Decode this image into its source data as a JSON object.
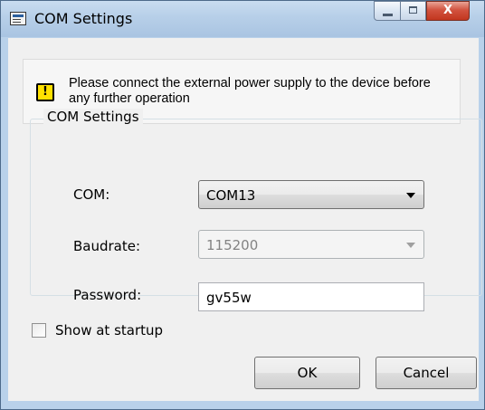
{
  "window": {
    "title": "COM Settings",
    "close_glyph": "X",
    "icons": {
      "app": "window-app-icon",
      "minimize": "minimize-icon",
      "maximize": "maximize-icon",
      "close": "close-icon"
    }
  },
  "notice": {
    "icon": "warning-icon",
    "icon_glyph": "!",
    "text": "Please connect the external power supply to the device before any further operation"
  },
  "group": {
    "title": "COM Settings",
    "com_label": "COM:",
    "com_value": "COM13",
    "baud_label": "Baudrate:",
    "baud_value": "115200",
    "password_label": "Password:",
    "password_value": "gv55w"
  },
  "footer": {
    "show_startup_label": "Show at startup",
    "show_startup_checked": false,
    "ok_label": "OK",
    "cancel_label": "Cancel"
  },
  "colors": {
    "close_button": "#c2361f",
    "warning_yellow": "#ffe100",
    "titlebar": "#b9d1ea"
  }
}
